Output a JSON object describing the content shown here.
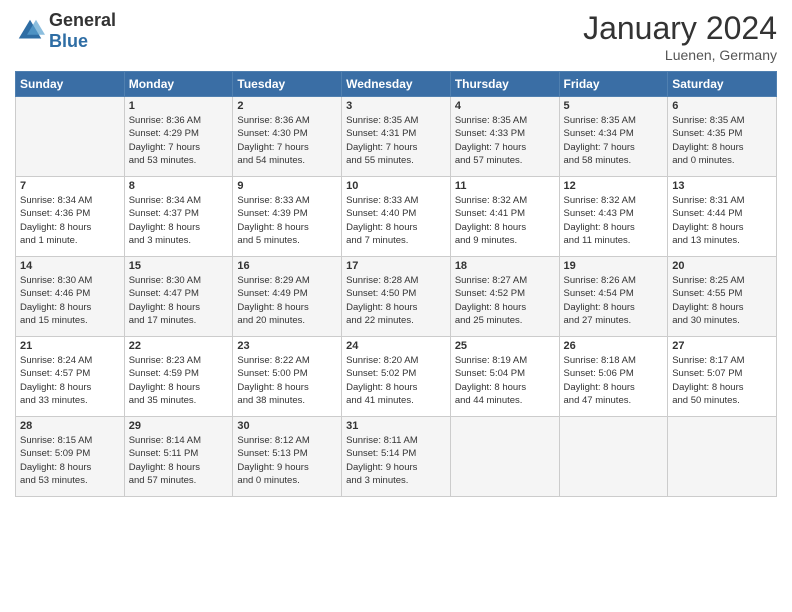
{
  "header": {
    "logo_general": "General",
    "logo_blue": "Blue",
    "month_year": "January 2024",
    "location": "Luenen, Germany"
  },
  "weekdays": [
    "Sunday",
    "Monday",
    "Tuesday",
    "Wednesday",
    "Thursday",
    "Friday",
    "Saturday"
  ],
  "weeks": [
    [
      {
        "day": "",
        "info": ""
      },
      {
        "day": "1",
        "info": "Sunrise: 8:36 AM\nSunset: 4:29 PM\nDaylight: 7 hours\nand 53 minutes."
      },
      {
        "day": "2",
        "info": "Sunrise: 8:36 AM\nSunset: 4:30 PM\nDaylight: 7 hours\nand 54 minutes."
      },
      {
        "day": "3",
        "info": "Sunrise: 8:35 AM\nSunset: 4:31 PM\nDaylight: 7 hours\nand 55 minutes."
      },
      {
        "day": "4",
        "info": "Sunrise: 8:35 AM\nSunset: 4:33 PM\nDaylight: 7 hours\nand 57 minutes."
      },
      {
        "day": "5",
        "info": "Sunrise: 8:35 AM\nSunset: 4:34 PM\nDaylight: 7 hours\nand 58 minutes."
      },
      {
        "day": "6",
        "info": "Sunrise: 8:35 AM\nSunset: 4:35 PM\nDaylight: 8 hours\nand 0 minutes."
      }
    ],
    [
      {
        "day": "7",
        "info": "Sunrise: 8:34 AM\nSunset: 4:36 PM\nDaylight: 8 hours\nand 1 minute."
      },
      {
        "day": "8",
        "info": "Sunrise: 8:34 AM\nSunset: 4:37 PM\nDaylight: 8 hours\nand 3 minutes."
      },
      {
        "day": "9",
        "info": "Sunrise: 8:33 AM\nSunset: 4:39 PM\nDaylight: 8 hours\nand 5 minutes."
      },
      {
        "day": "10",
        "info": "Sunrise: 8:33 AM\nSunset: 4:40 PM\nDaylight: 8 hours\nand 7 minutes."
      },
      {
        "day": "11",
        "info": "Sunrise: 8:32 AM\nSunset: 4:41 PM\nDaylight: 8 hours\nand 9 minutes."
      },
      {
        "day": "12",
        "info": "Sunrise: 8:32 AM\nSunset: 4:43 PM\nDaylight: 8 hours\nand 11 minutes."
      },
      {
        "day": "13",
        "info": "Sunrise: 8:31 AM\nSunset: 4:44 PM\nDaylight: 8 hours\nand 13 minutes."
      }
    ],
    [
      {
        "day": "14",
        "info": "Sunrise: 8:30 AM\nSunset: 4:46 PM\nDaylight: 8 hours\nand 15 minutes."
      },
      {
        "day": "15",
        "info": "Sunrise: 8:30 AM\nSunset: 4:47 PM\nDaylight: 8 hours\nand 17 minutes."
      },
      {
        "day": "16",
        "info": "Sunrise: 8:29 AM\nSunset: 4:49 PM\nDaylight: 8 hours\nand 20 minutes."
      },
      {
        "day": "17",
        "info": "Sunrise: 8:28 AM\nSunset: 4:50 PM\nDaylight: 8 hours\nand 22 minutes."
      },
      {
        "day": "18",
        "info": "Sunrise: 8:27 AM\nSunset: 4:52 PM\nDaylight: 8 hours\nand 25 minutes."
      },
      {
        "day": "19",
        "info": "Sunrise: 8:26 AM\nSunset: 4:54 PM\nDaylight: 8 hours\nand 27 minutes."
      },
      {
        "day": "20",
        "info": "Sunrise: 8:25 AM\nSunset: 4:55 PM\nDaylight: 8 hours\nand 30 minutes."
      }
    ],
    [
      {
        "day": "21",
        "info": "Sunrise: 8:24 AM\nSunset: 4:57 PM\nDaylight: 8 hours\nand 33 minutes."
      },
      {
        "day": "22",
        "info": "Sunrise: 8:23 AM\nSunset: 4:59 PM\nDaylight: 8 hours\nand 35 minutes."
      },
      {
        "day": "23",
        "info": "Sunrise: 8:22 AM\nSunset: 5:00 PM\nDaylight: 8 hours\nand 38 minutes."
      },
      {
        "day": "24",
        "info": "Sunrise: 8:20 AM\nSunset: 5:02 PM\nDaylight: 8 hours\nand 41 minutes."
      },
      {
        "day": "25",
        "info": "Sunrise: 8:19 AM\nSunset: 5:04 PM\nDaylight: 8 hours\nand 44 minutes."
      },
      {
        "day": "26",
        "info": "Sunrise: 8:18 AM\nSunset: 5:06 PM\nDaylight: 8 hours\nand 47 minutes."
      },
      {
        "day": "27",
        "info": "Sunrise: 8:17 AM\nSunset: 5:07 PM\nDaylight: 8 hours\nand 50 minutes."
      }
    ],
    [
      {
        "day": "28",
        "info": "Sunrise: 8:15 AM\nSunset: 5:09 PM\nDaylight: 8 hours\nand 53 minutes."
      },
      {
        "day": "29",
        "info": "Sunrise: 8:14 AM\nSunset: 5:11 PM\nDaylight: 8 hours\nand 57 minutes."
      },
      {
        "day": "30",
        "info": "Sunrise: 8:12 AM\nSunset: 5:13 PM\nDaylight: 9 hours\nand 0 minutes."
      },
      {
        "day": "31",
        "info": "Sunrise: 8:11 AM\nSunset: 5:14 PM\nDaylight: 9 hours\nand 3 minutes."
      },
      {
        "day": "",
        "info": ""
      },
      {
        "day": "",
        "info": ""
      },
      {
        "day": "",
        "info": ""
      }
    ]
  ]
}
